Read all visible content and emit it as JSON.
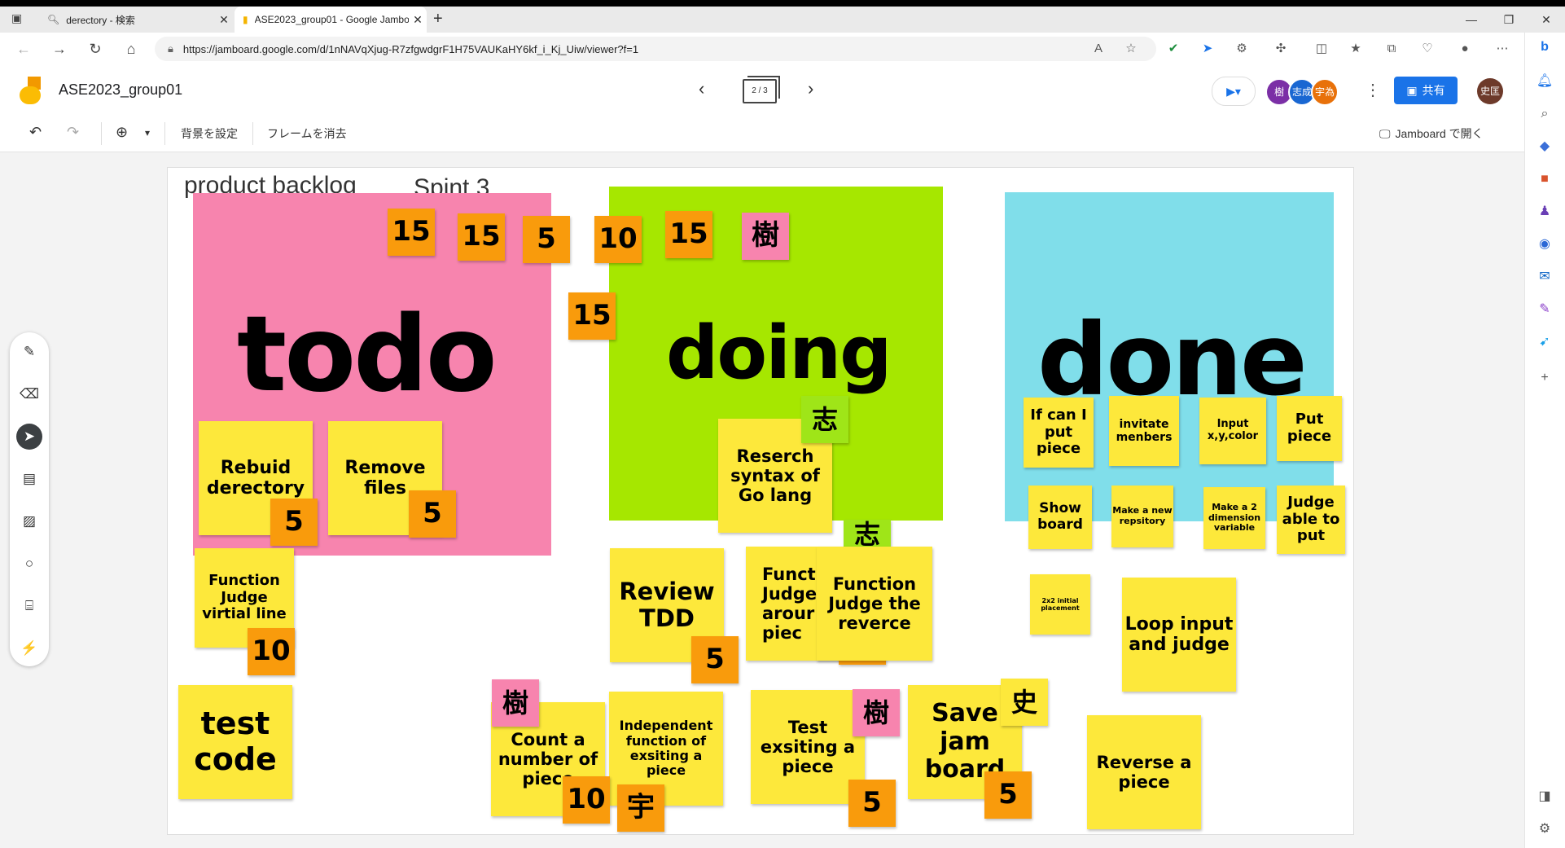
{
  "browser": {
    "tabs": [
      {
        "label": "derectory - 検索"
      },
      {
        "label": "ASE2023_group01 - Google Jamboard"
      }
    ],
    "url": "https://jamboard.google.com/d/1nNAVqXjug-R7zfgwdgrF1H75VAUKaHY6kf_i_Kj_Uiw/viewer?f=1"
  },
  "app": {
    "title": "ASE2023_group01",
    "frame_indicator": "2 / 3",
    "avatars": [
      "樹",
      "志成",
      "宇為"
    ],
    "share_label": "共有",
    "user_avatar": "史匡"
  },
  "toolbar": {
    "set_background": "背景を設定",
    "clear_frame": "フレームを消去",
    "open_in_jamboard": "Jamboard で開く"
  },
  "board": {
    "heading1": "product backlog",
    "heading2": "Spint 3",
    "columns": {
      "todo": "todo",
      "doing": "doing",
      "done": "done"
    },
    "top_numbers": [
      "15",
      "15",
      "5",
      "10",
      "15",
      "樹",
      "15"
    ],
    "notes": {
      "rebuild": "Rebuid derectory",
      "rebuild_pts": "5",
      "remove": "Remove files",
      "remove_pts": "5",
      "virtial": "Function Judge virtial line",
      "virtial_pts": "10",
      "testcode": "test code",
      "research": "Reserch syntax of Go lang",
      "research_mark": "志",
      "review": "Review TDD",
      "review_pts": "5",
      "around_partial": "Functi Judge arour piec",
      "around_mark": "志",
      "reverce": "Function Judge the reverce",
      "count": "Count a number of piece",
      "count_mark": "樹",
      "count_pts": "10",
      "independent": "Independent function of exsiting a piece",
      "independent_mark": "宇",
      "test_exist": "Test exsiting a piece",
      "test_exist_mark": "樹",
      "test_exist_pts": "5",
      "save": "Save jam board",
      "save_mark": "史",
      "save_pts": "5",
      "ifcan": "If can I put piece",
      "invitate": "invitate menbers",
      "inputxy": "Input x,y,color",
      "putpiece": "Put piece",
      "showboard": "Show board",
      "newrepo": "Make a new repsitory",
      "twodim": "Make a 2 dimension variable",
      "judgeput": "Judge able to put",
      "initial": "2x2 initial placement",
      "loop": "Loop input and judge",
      "reverse": "Reverse a piece"
    }
  }
}
